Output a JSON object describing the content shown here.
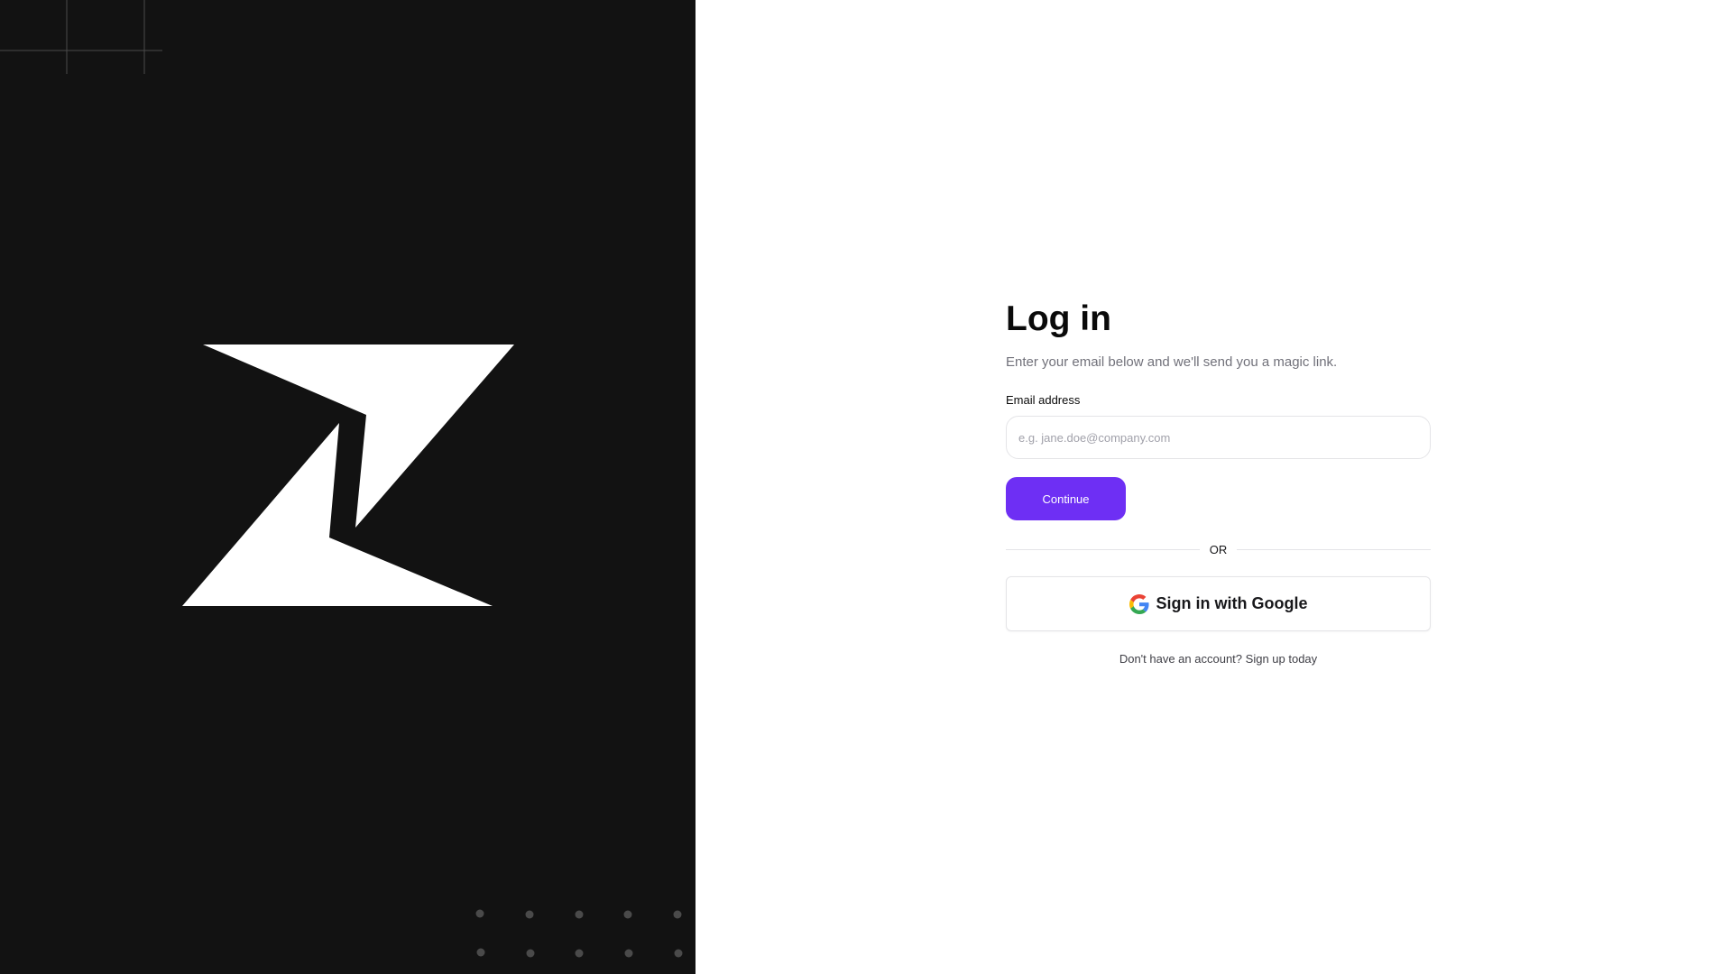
{
  "branding": {
    "logo_icon": "lightning-z-logo",
    "panel_color": "#121212"
  },
  "login": {
    "title": "Log in",
    "subtitle": "Enter your email below and we'll send you a magic link.",
    "email_label": "Email address",
    "email_placeholder": "e.g. jane.doe@company.com",
    "email_value": "",
    "continue_label": "Continue",
    "divider_text": "OR",
    "google_icon": "google-g-icon",
    "google_label": "Sign in with Google",
    "signup_prompt": "Don't have an account?",
    "signup_link": "Sign up today"
  },
  "colors": {
    "accent": "#6e2ff4",
    "text_primary": "#0a0a0a",
    "text_muted": "#71717a",
    "border": "#e4e4e7"
  }
}
